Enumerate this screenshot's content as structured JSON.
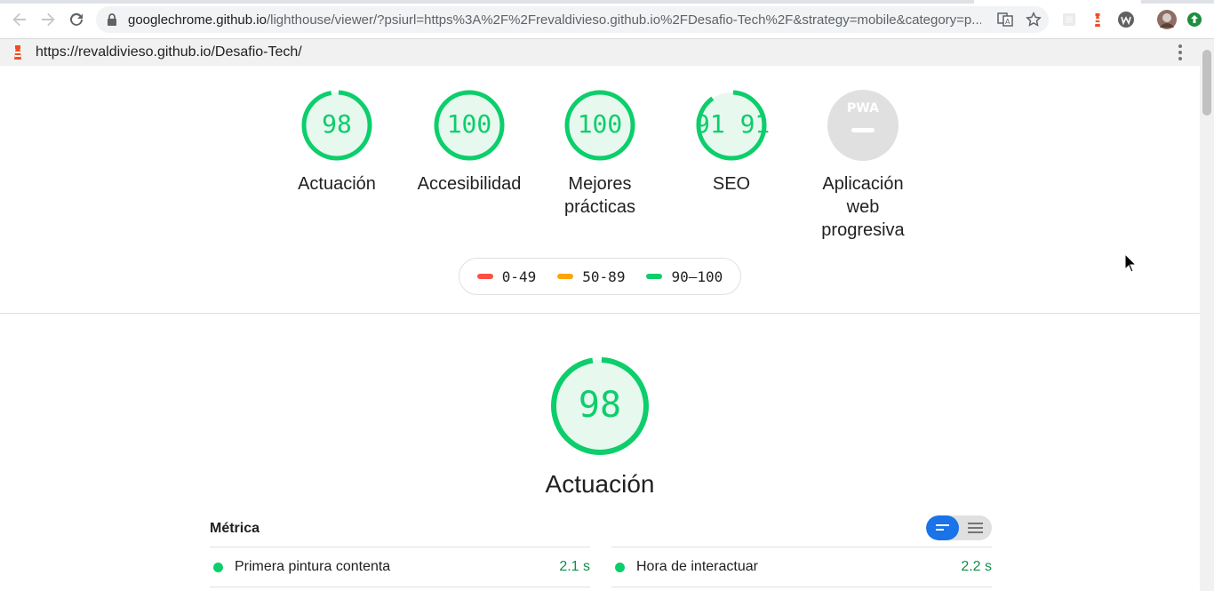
{
  "browser": {
    "url_host": "googlechrome.github.io",
    "url_path": "/lighthouse/viewer/?psiurl=https%3A%2F%2Frevaldivieso.github.io%2FDesafio-Tech%2F&strategy=mobile&category=p...",
    "icons": [
      "back-arrow-icon",
      "forward-arrow-icon",
      "reload-icon",
      "lock-icon",
      "translate-icon",
      "star-icon",
      "extension-icon",
      "lighthouse-extension-icon",
      "wappalyzer-icon",
      "profile-avatar",
      "update-icon"
    ]
  },
  "report": {
    "url": "https://revaldivieso.github.io/Desafio-Tech/"
  },
  "gauges": [
    {
      "score": "98",
      "label": "Actuación",
      "value": 0.98
    },
    {
      "score": "100",
      "label": "Accesibilidad",
      "value": 1.0
    },
    {
      "score": "100",
      "label": "Mejores prácticas",
      "value": 1.0
    },
    {
      "score": "91 91",
      "label": "SEO",
      "value": 0.91
    },
    {
      "score": "PWA",
      "label": "Aplicación web progresiva",
      "value": null
    }
  ],
  "legend": [
    {
      "range": "0-49",
      "color": "#ff4e42"
    },
    {
      "range": "50-89",
      "color": "#ffa400"
    },
    {
      "range": "90–100",
      "color": "#0cce6b"
    }
  ],
  "performance": {
    "score": "98",
    "value": 0.98,
    "title": "Actuación",
    "metrics_header": "Métrica",
    "metrics": [
      {
        "name": "Primera pintura contenta",
        "value": "2.1 s"
      },
      {
        "name": "Hora de interactuar",
        "value": "2.2 s"
      }
    ]
  },
  "colors": {
    "pass": "#0cce6b",
    "pass_bg": "#e7f8ef",
    "pass_text": "#0d8f4a",
    "accent": "#1a73e8"
  }
}
